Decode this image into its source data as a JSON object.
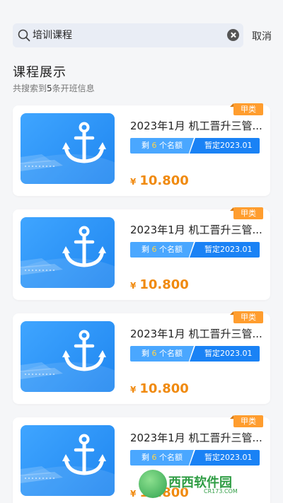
{
  "search": {
    "value": "培训课程",
    "cancel_label": "取消",
    "search_icon": "search-icon",
    "clear_icon": "clear-icon"
  },
  "section": {
    "title": "课程展示",
    "subtitle_prefix": "共搜索到",
    "subtitle_count": "5",
    "subtitle_suffix": "条开班信息"
  },
  "courses": [
    {
      "tag": "甲类",
      "title": "2023年1月 机工晋升三管...",
      "remain_prefix": "剩",
      "remain_count": "6",
      "remain_suffix": "个名额",
      "date_label": "暂定2023.01",
      "currency": "¥",
      "price": "10.800"
    },
    {
      "tag": "甲类",
      "title": "2023年1月 机工晋升三管...",
      "remain_prefix": "剩",
      "remain_count": "6",
      "remain_suffix": "个名额",
      "date_label": "暂定2023.01",
      "currency": "¥",
      "price": "10.800"
    },
    {
      "tag": "甲类",
      "title": "2023年1月 机工晋升三管...",
      "remain_prefix": "剩",
      "remain_count": "6",
      "remain_suffix": "个名额",
      "date_label": "暂定2023.01",
      "currency": "¥",
      "price": "10.800"
    },
    {
      "tag": "甲类",
      "title": "2023年1月 机工晋升三管...",
      "remain_prefix": "剩",
      "remain_count": "6",
      "remain_suffix": "个名额",
      "date_label": "暂定2023.01",
      "currency": "¥",
      "price": "10.800"
    }
  ],
  "watermark": {
    "text": "西西软件园",
    "sub": "CR173.COM"
  },
  "colors": {
    "accent_blue": "#1a82f5",
    "light_blue": "#4aa7ff",
    "price_orange": "#f08a10",
    "tag_orange": "#ff9d2e"
  }
}
